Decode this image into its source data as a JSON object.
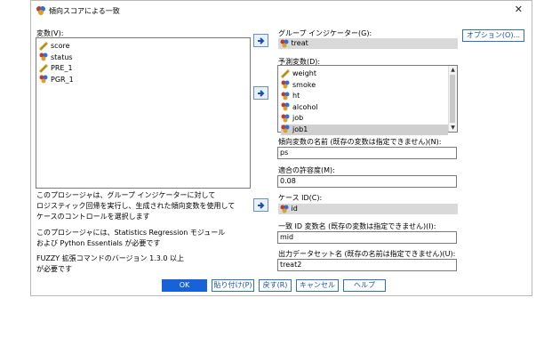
{
  "window": {
    "title": "傾向スコアによる一致",
    "close": "✕"
  },
  "left": {
    "variables_label": "変数(V):",
    "variables": [
      {
        "name": "score",
        "icon": "scale-ruler-icon"
      },
      {
        "name": "status",
        "icon": "nominal-icon"
      },
      {
        "name": "PRE_1",
        "icon": "scale-ruler-icon"
      },
      {
        "name": "PGR_1",
        "icon": "nominal-icon"
      }
    ],
    "desc1_line1": "このプロシージャは、グループ インジケーターに対して",
    "desc1_line2": "ロジスティック回帰を実行し、生成された傾向変数を使用して",
    "desc1_line3": "ケースのコントロールを選択します",
    "desc2_line1": "このプロシージャには、Statistics Regression モジュール",
    "desc2_line2": "および Python Essentials が必要です",
    "desc3_line1": "FUZZY 拡張コマンドのバージョン 1.3.0 以上",
    "desc3_line2": "が必要です"
  },
  "right": {
    "group_indicator_label": "グループ インジケーター(G):",
    "group_indicator_value": "treat",
    "options_button": "オプション(O)...",
    "predictors_label": "予測変数(D):",
    "predictors": [
      {
        "name": "weight",
        "icon": "scale-ruler-icon"
      },
      {
        "name": "smoke",
        "icon": "nominal-icon"
      },
      {
        "name": "ht",
        "icon": "nominal-icon"
      },
      {
        "name": "alcohol",
        "icon": "nominal-icon"
      },
      {
        "name": "job",
        "icon": "nominal-icon"
      },
      {
        "name": "job1",
        "icon": "nominal-icon"
      }
    ],
    "propensity_label": "傾向変数の名前 (既存の変数は指定できません)(N):",
    "propensity_value": "ps",
    "tolerance_label": "適合の許容度(M):",
    "tolerance_value": "0.08",
    "case_id_label": "ケース ID(C):",
    "case_id_value": "id",
    "match_id_label": "一致 ID 変数名 (既存の変数は指定できません)(I):",
    "match_id_value": "mid",
    "output_dataset_label": "出力データセット名 (既存の名前は指定できません)(U):",
    "output_dataset_value": "treat2"
  },
  "buttons": {
    "ok": "OK",
    "paste": "貼り付け(P)",
    "reset": "戻す(R)",
    "cancel": "キャンセル",
    "help": "ヘルプ"
  },
  "colors": {
    "accent": "#1762d6",
    "selected": "#cfcfcf"
  }
}
